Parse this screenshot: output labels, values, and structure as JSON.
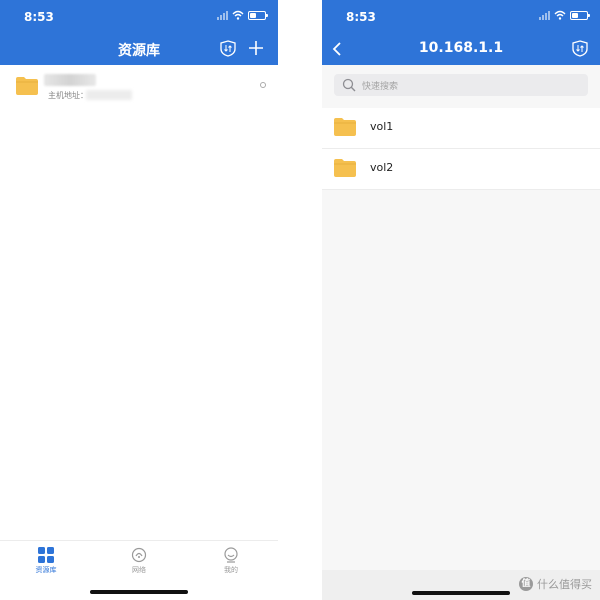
{
  "left_screen": {
    "status": {
      "time": "8:53"
    },
    "nav": {
      "title": "资源库"
    },
    "library_item": {
      "host_label": "主机地址："
    },
    "tabbar": {
      "tabs": [
        {
          "label": "资源库",
          "icon": "grid-icon",
          "active": true
        },
        {
          "label": "网络",
          "icon": "network-icon",
          "active": false
        },
        {
          "label": "我的",
          "icon": "profile-icon",
          "active": false
        }
      ]
    }
  },
  "right_screen": {
    "status": {
      "time": "8:53"
    },
    "nav": {
      "title": "10.168.1.1"
    },
    "search": {
      "placeholder": "快速搜索"
    },
    "folders": [
      {
        "label": "vol1"
      },
      {
        "label": "vol2"
      }
    ]
  },
  "watermark": {
    "badge": "值",
    "text": "什么值得买"
  },
  "colors": {
    "header_blue": "#2e74d8",
    "folder_yellow": "#f5c04f",
    "tab_active": "#2e74d8"
  }
}
